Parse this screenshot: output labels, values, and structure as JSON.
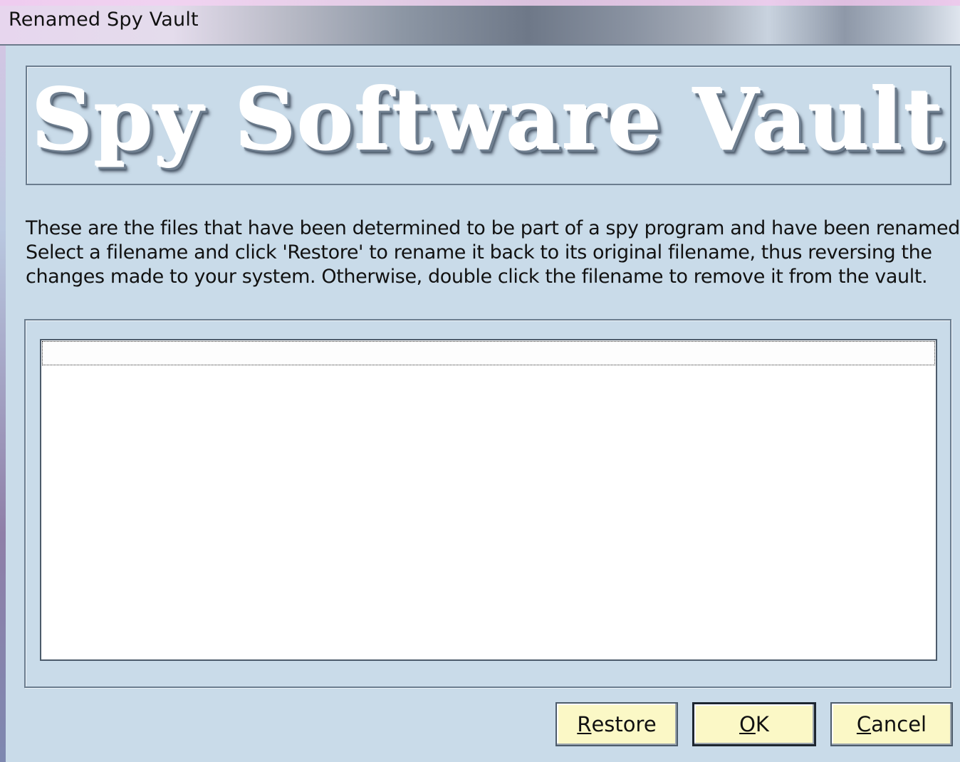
{
  "window": {
    "title": "Renamed Spy Vault"
  },
  "banner": {
    "heading": "Spy Software Vault"
  },
  "description": {
    "lines": [
      "These are the files that have been determined to be part of a spy program and have been renamed.",
      "Select a filename and click 'Restore' to rename it back to its original filename, thus reversing the",
      "changes made to your system.  Otherwise, double click the filename to remove it from the vault."
    ]
  },
  "file_list": {
    "items": [
      ""
    ]
  },
  "buttons": {
    "restore": {
      "access_key": "R",
      "rest": "estore"
    },
    "ok": {
      "access_key": "O",
      "rest": "K"
    },
    "cancel": {
      "access_key": "C",
      "rest": "ancel"
    }
  },
  "colors": {
    "window_background": "#c9dbe9",
    "button_face": "#fbf8c6"
  }
}
